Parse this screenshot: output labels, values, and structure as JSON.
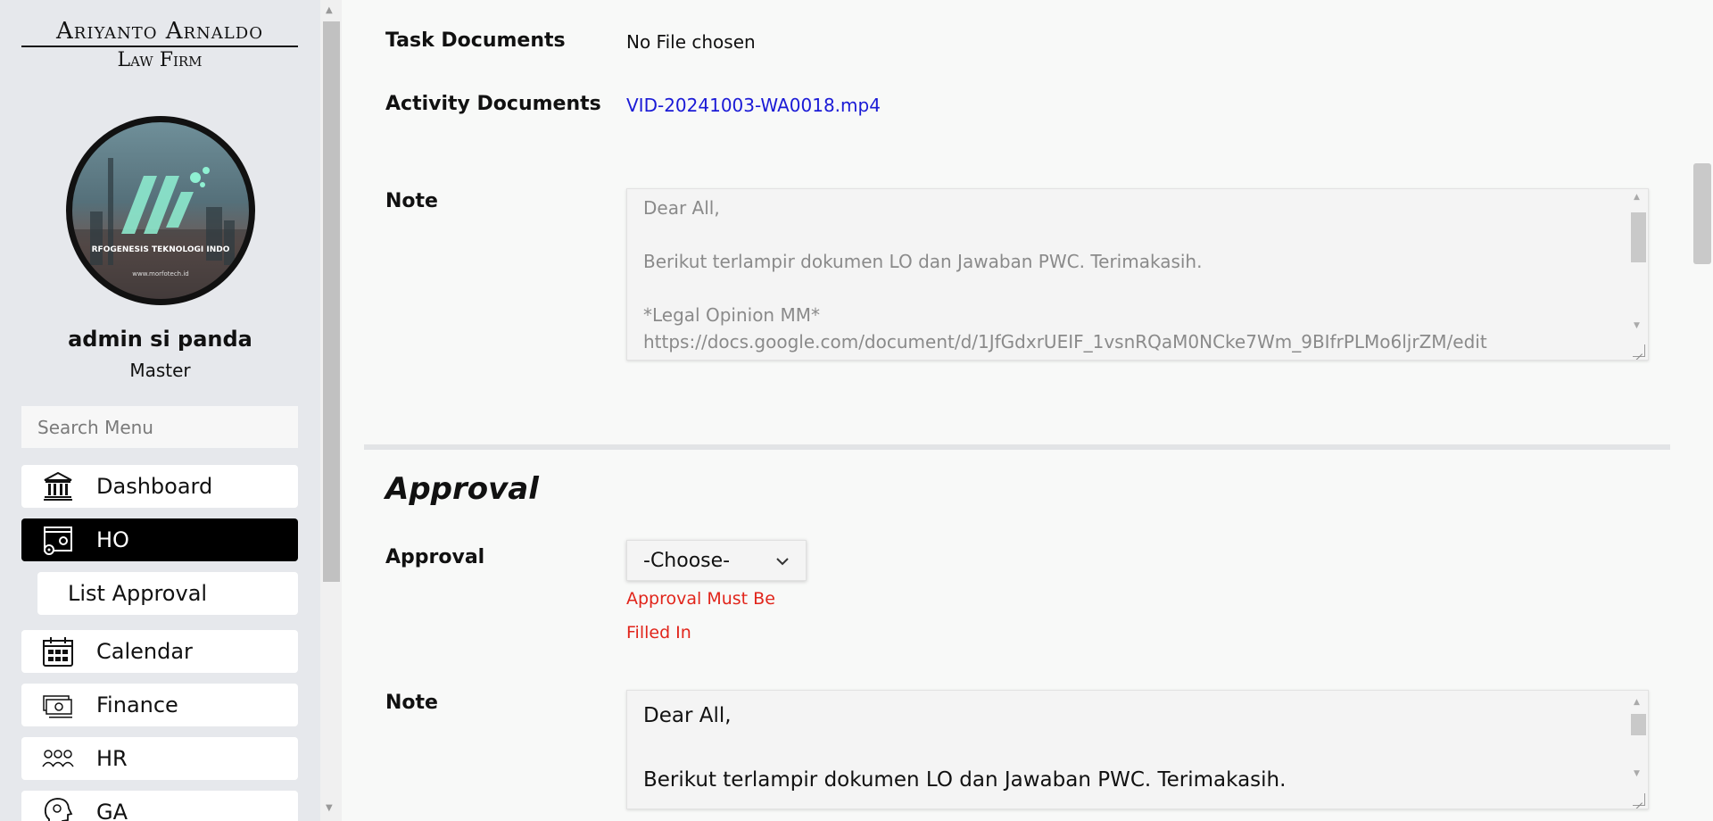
{
  "sidebar": {
    "logo": {
      "title": "Ariyanto Arnaldo",
      "subtitle": "Law Firm"
    },
    "user": {
      "name": "admin si panda",
      "role": "Master"
    },
    "search": {
      "placeholder": "Search Menu",
      "value": ""
    },
    "menu": {
      "dashboard": {
        "label": "Dashboard",
        "icon": "bank-icon"
      },
      "ho": {
        "label": "HO",
        "icon": "web-settings-icon",
        "active": true
      },
      "list_approval": {
        "label": "List Approval"
      },
      "calendar": {
        "label": "Calendar",
        "icon": "calendar-icon"
      },
      "finance": {
        "label": "Finance",
        "icon": "money-icon"
      },
      "hr": {
        "label": "HR",
        "icon": "people-icon"
      },
      "ga": {
        "label": "GA",
        "icon": "head-gear-icon"
      }
    }
  },
  "main": {
    "task_documents": {
      "label": "Task Documents",
      "value": "No File chosen"
    },
    "activity_documents": {
      "label": "Activity Documents",
      "value": "VID-20241003-WA0018.mp4"
    },
    "note_readonly": {
      "label": "Note",
      "value": "Dear All,\n\nBerikut terlampir dokumen LO dan Jawaban PWC. Terimakasih.\n\n*Legal Opinion MM*\nhttps://docs.google.com/document/d/1JfGdxrUEIF_1vsnRQaM0NCke7Wm_9BIfrPLMo6ljrZM/edit"
    },
    "approval_section": {
      "title": "Approval",
      "approval": {
        "label": "Approval",
        "selected": "-Choose-",
        "error_line1": "Approval Must Be",
        "error_line2": "Filled In"
      },
      "note": {
        "label": "Note",
        "value": "Dear All,\n\nBerikut terlampir dokumen LO dan Jawaban PWC. Terimakasih."
      }
    }
  },
  "colors": {
    "link": "#1a1ad6",
    "error": "#e1251b",
    "active_menu": "#000000",
    "sidebar_bg": "#e6e8ec"
  }
}
